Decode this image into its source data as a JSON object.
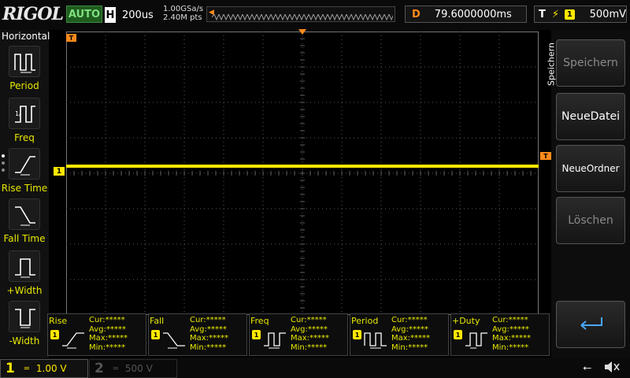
{
  "header": {
    "logo": "RIGOL",
    "run_mode": "AUTO",
    "timebase_tag": "H",
    "timebase": "200us",
    "sample_rate": "1.00GSa/s",
    "mem_depth": "2.40M pts",
    "delay_tag": "D",
    "delay": "79.6000000ms",
    "trigger_tag": "T",
    "trigger_edge_icon": "rising-edge-icon",
    "trigger_source": "1",
    "trigger_level": "500mV"
  },
  "left_menu": {
    "title": "Horizontal",
    "items": [
      {
        "label": "Period",
        "icon": "period-icon"
      },
      {
        "label": "Freq",
        "icon": "freq-icon"
      },
      {
        "label": "Rise Time",
        "icon": "rise-time-icon"
      },
      {
        "label": "Fall Time",
        "icon": "fall-time-icon"
      },
      {
        "label": "+Width",
        "icon": "positive-width-icon"
      },
      {
        "label": "-Width",
        "icon": "negative-width-icon"
      }
    ]
  },
  "right_menu": {
    "title": "Speichern",
    "buttons": [
      {
        "label": "Speichern",
        "enabled": false
      },
      {
        "label": "NeueDatei",
        "enabled": true
      },
      {
        "label": "NeueOrdner",
        "enabled": true
      },
      {
        "label": "Löschen",
        "enabled": false
      }
    ],
    "return_icon": "return-arrow-icon"
  },
  "measurements": [
    {
      "name": "Rise",
      "source": "1",
      "cur": "Cur:*****",
      "avg": "Avg:*****",
      "max": "Max:*****",
      "min": "Min:*****"
    },
    {
      "name": "Fall",
      "source": "1",
      "cur": "Cur:*****",
      "avg": "Avg:*****",
      "max": "Max:*****",
      "min": "Min:*****"
    },
    {
      "name": "Freq",
      "source": "1",
      "cur": "Cur:*****",
      "avg": "Avg:*****",
      "max": "Max:*****",
      "min": "Min:*****"
    },
    {
      "name": "Period",
      "source": "1",
      "cur": "Cur:*****",
      "avg": "Avg:*****",
      "max": "Max:*****",
      "min": "Min:*****"
    },
    {
      "name": "+Duty",
      "source": "1",
      "cur": "Cur:*****",
      "avg": "Avg:*****",
      "max": "Max:*****",
      "min": "Min:*****"
    }
  ],
  "channels": {
    "ch1": {
      "number": "1",
      "coupling": "═",
      "scale": "1.00 V",
      "color": "#ffe800"
    },
    "ch2": {
      "number": "2",
      "coupling": "═",
      "scale": "500 V",
      "color": "#555555"
    }
  },
  "markers": {
    "ch1": "1",
    "trigger_pos": "T",
    "trigger_level": "T"
  },
  "status": {
    "usb_icon": "usb-icon",
    "mute_icon": "speaker-muted-icon"
  },
  "colors": {
    "trace": "#ffe800",
    "trigger": "#ff8a1c",
    "grid": "#5a5a5a"
  }
}
